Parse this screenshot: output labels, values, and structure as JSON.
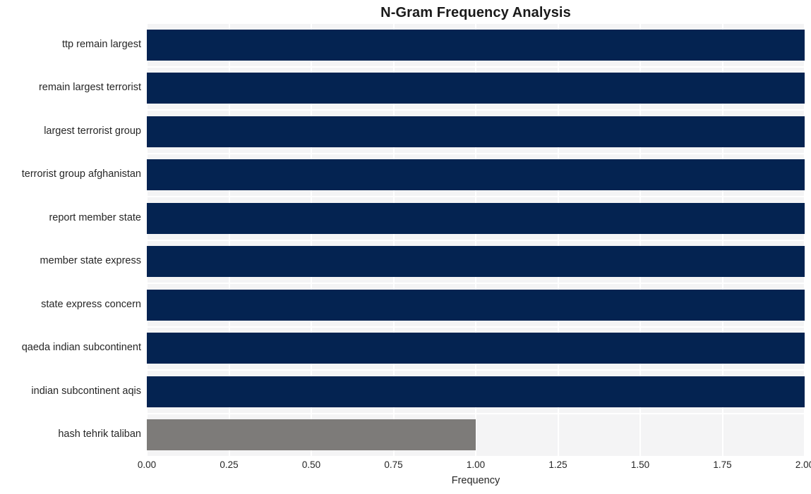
{
  "chart_data": {
    "type": "bar",
    "orientation": "horizontal",
    "title": "N-Gram Frequency Analysis",
    "xlabel": "Frequency",
    "ylabel": "",
    "categories": [
      "ttp remain largest",
      "remain largest terrorist",
      "largest terrorist group",
      "terrorist group afghanistan",
      "report member state",
      "member state express",
      "state express concern",
      "qaeda indian subcontinent",
      "indian subcontinent aqis",
      "hash tehrik taliban"
    ],
    "values": [
      2,
      2,
      2,
      2,
      2,
      2,
      2,
      2,
      2,
      1
    ],
    "bar_colors": [
      "#042351",
      "#042351",
      "#042351",
      "#042351",
      "#042351",
      "#042351",
      "#042351",
      "#042351",
      "#042351",
      "#7d7b79"
    ],
    "xlim": [
      0,
      2
    ],
    "ylim_categories": 10,
    "xticks": [
      0,
      0.25,
      0.5,
      0.75,
      1,
      1.25,
      1.5,
      1.75,
      2
    ],
    "xticklabels": [
      "0.00",
      "0.25",
      "0.50",
      "0.75",
      "1.00",
      "1.25",
      "1.50",
      "1.75",
      "2.00"
    ],
    "grid": true,
    "grid_color": "#ffffff",
    "plot_background": "#f4f4f5",
    "figure_background": "#ffffff",
    "legend": null,
    "annotations": []
  }
}
